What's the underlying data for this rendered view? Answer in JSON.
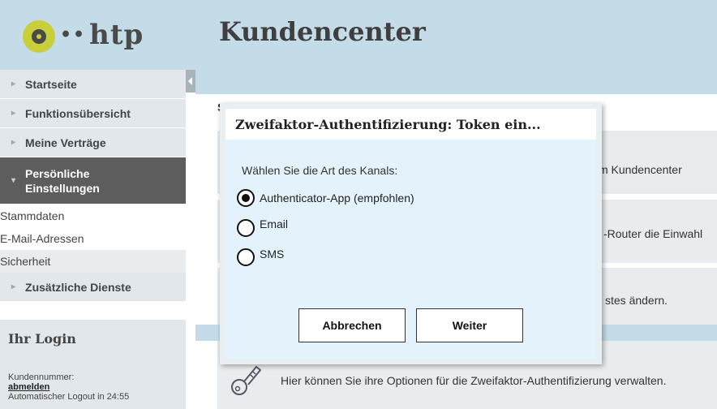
{
  "header": {
    "logo_dots": "••",
    "logo_text": "htp",
    "title": "Kundencenter"
  },
  "sidebar": {
    "items": [
      {
        "label": "Startseite"
      },
      {
        "label": "Funktionsübersicht"
      },
      {
        "label": "Meine Verträge"
      },
      {
        "label": "Persönliche Einstellungen"
      }
    ],
    "sub_items": [
      "Stammdaten",
      "E-Mail-Adressen",
      "Sicherheit"
    ],
    "extra_item": "Zusätzliche Dienste"
  },
  "login": {
    "title": "Ihr Login",
    "customer_label": "Kundennummer:",
    "logout_link": "abmelden",
    "auto_logout": "Automatischer Logout in 24:55"
  },
  "content": {
    "card1_text": "m Kundencenter",
    "card2_text": "-Router die Einwahl",
    "card3_text": "stes ändern.",
    "card4_text": "Hier können Sie ihre Optionen für die Zweifaktor-Authentifizierung verwalten.",
    "band_letter": "S"
  },
  "modal": {
    "title": "Zweifaktor-Authentifizierung: Token ein...",
    "prompt": "Wählen Sie die Art des Kanals:",
    "options": [
      {
        "label": "Authenticator-App (empfohlen)",
        "checked": true
      },
      {
        "label": "Email",
        "checked": false
      },
      {
        "label": "SMS",
        "checked": false
      }
    ],
    "cancel_label": "Abbrechen",
    "next_label": "Weiter"
  },
  "colors": {
    "header_bg": "#c4dbe8",
    "active_nav": "#5d5d5d",
    "logo_accent": "#c9cf3a",
    "modal_body": "#e4f3fb"
  },
  "icons": [
    "arrow-right-icon",
    "chevron-left-icon",
    "key-icon"
  ]
}
